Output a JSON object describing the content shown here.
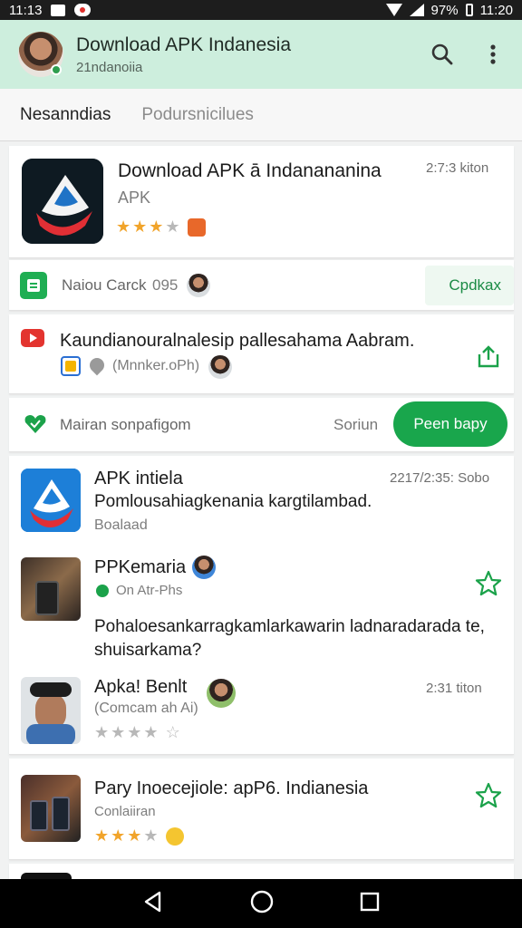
{
  "status_bar": {
    "time_left": "11:13",
    "battery": "97%",
    "time_right": "11:20"
  },
  "app_bar": {
    "title": "Download APK Indanesia",
    "subtitle": "21ndanoiia"
  },
  "tabs": [
    {
      "label": "Nesanndias"
    },
    {
      "label": "Podursnicilues"
    }
  ],
  "featured": {
    "name": "Download APK ā Indanananina",
    "tag": "APK",
    "time": "2:7:3 kiton"
  },
  "news_row": {
    "label": "Naiou Carck",
    "code": "095",
    "action": "Cpdkax"
  },
  "promo": {
    "text": "Kaundianouralnalesip pallesahama Aabram.",
    "meta": "(Mnnker.oPh)"
  },
  "search_row": {
    "label": "Mairan sonpafigom",
    "sort": "Soriun",
    "button": "Peen bapy"
  },
  "list": [
    {
      "name": "APK intiela",
      "desc": "Pomlousahiagkenania kargtilambad.",
      "status": "Boalaad",
      "time": "2217/2:35: Sobo"
    },
    {
      "name": "PPKemaria",
      "meta": "On Atr-Phs",
      "comment": "Pohaloesankarragkamlarkawarin ladnaradarada te, shuisarkama?"
    },
    {
      "name": "Apka! Benlt",
      "meta": "(Comcam ah Ai)",
      "time": "2:31 titon"
    },
    {
      "name": "Pary Inoecejiole: apP6. Indianesia",
      "meta": "Conlaiiran"
    }
  ],
  "colors": {
    "accent": "#19a64c",
    "app_bar_bg": "#cdeedd",
    "star": "#f1a42b"
  }
}
